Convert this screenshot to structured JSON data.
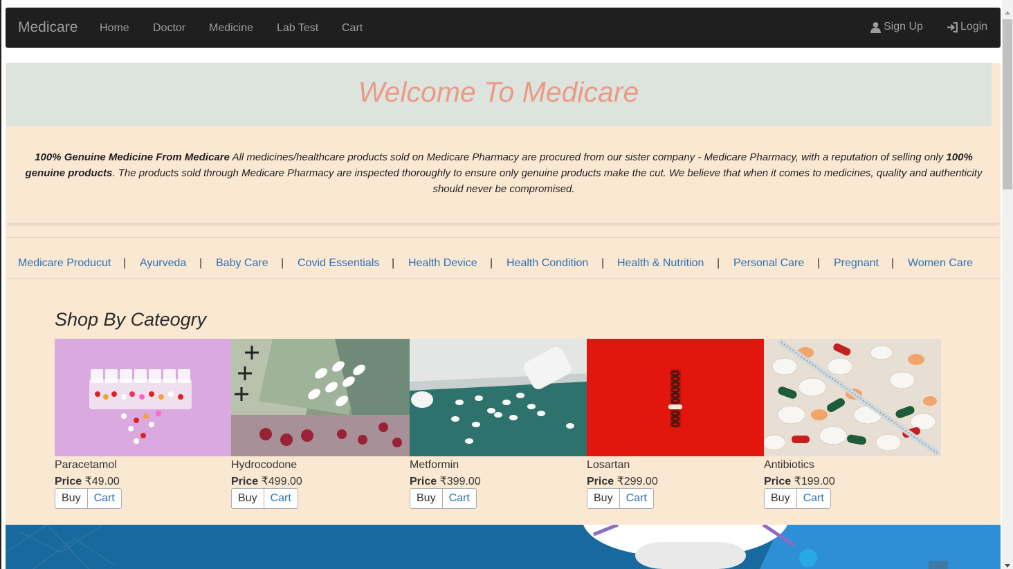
{
  "navbar": {
    "brand": "Medicare",
    "links": [
      "Home",
      "Doctor",
      "Medicine",
      "Lab Test",
      "Cart"
    ],
    "signup": "Sign Up",
    "login": "Login"
  },
  "welcome": {
    "title": "Welcome To Medicare",
    "intro_bold1": "100% Genuine Medicine From Medicare",
    "intro_text1": " All medicines/healthcare products sold on Medicare Pharmacy are procured from our sister company - Medicare Pharmacy, with a reputation of selling only ",
    "intro_bold2": "100% genuine products",
    "intro_text2": ". The products sold through Medicare Pharmacy are inspected thoroughly to ensure only genuine products make the cut. We believe that when it comes to medicines, quality and authenticity should never be compromised."
  },
  "categories": [
    "Medicare Producut",
    "Ayurveda",
    "Baby Care",
    "Covid Essentials",
    "Health Device",
    "Health Condition",
    "Health & Nutrition",
    "Personal Care",
    "Pregnant",
    "Women Care"
  ],
  "category_separator": "|",
  "shop": {
    "title": "Shop By Cateogry",
    "price_label": "Price",
    "buy_label": "Buy",
    "cart_label": "Cart",
    "products": [
      {
        "name": "Paracetamol",
        "price": "₹49.00"
      },
      {
        "name": "Hydrocodone",
        "price": "₹499.00"
      },
      {
        "name": "Metformin",
        "price": "₹399.00"
      },
      {
        "name": "Losartan",
        "price": "₹299.00"
      },
      {
        "name": "Antibiotics",
        "price": "₹199.00"
      }
    ]
  },
  "colors": {
    "navbar_bg": "#1f1f1f",
    "page_bg": "#fae8d3",
    "welcome_band": "#dde4dd",
    "welcome_title": "#ea9b86",
    "link": "#2c6fb4",
    "banner": "#18699e"
  },
  "icons": {
    "signup": "user-icon",
    "login": "login-icon"
  }
}
